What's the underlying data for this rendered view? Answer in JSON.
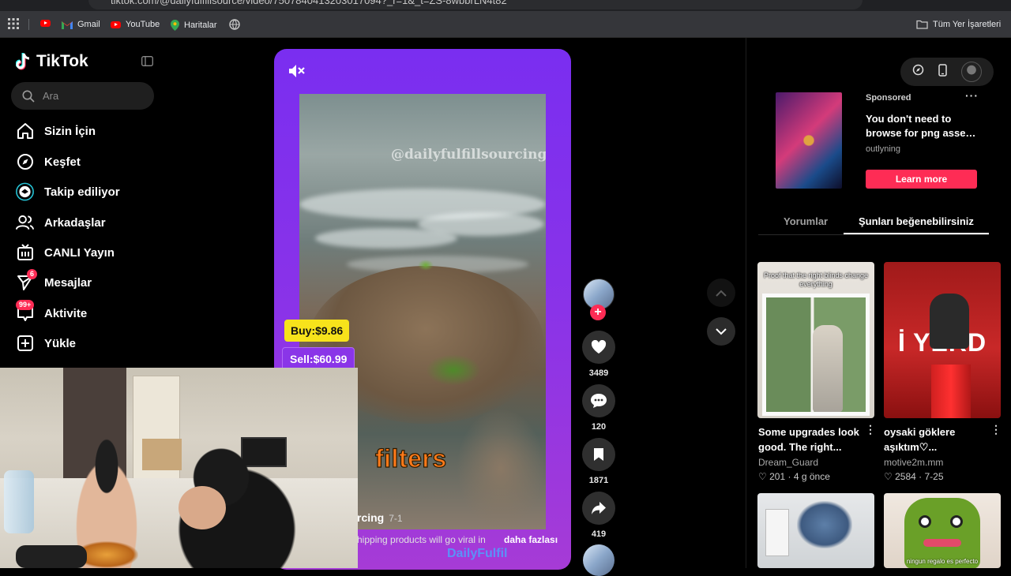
{
  "browser": {
    "url": "tiktok.com/@dailyfulfillsource/video/7507840413203017094?_r=1&_t=ZS-8wbbrLN4t82",
    "bookmarks": [
      {
        "label": "Gmail"
      },
      {
        "label": "YouTube"
      },
      {
        "label": "Haritalar"
      }
    ],
    "all_bookmarks_label": "Tüm Yer İşaretleri"
  },
  "sidebar": {
    "logo": "TikTok",
    "search_placeholder": "Ara",
    "items": [
      {
        "label": "Sizin İçin",
        "icon": "home-icon"
      },
      {
        "label": "Keşfet",
        "icon": "compass-icon"
      },
      {
        "label": "Takip ediliyor",
        "icon": "following-icon"
      },
      {
        "label": "Arkadaşlar",
        "icon": "friends-icon"
      },
      {
        "label": "CANLI Yayın",
        "icon": "live-icon"
      },
      {
        "label": "Mesajlar",
        "icon": "messages-icon",
        "badge": "6"
      },
      {
        "label": "Aktivite",
        "icon": "activity-icon",
        "badge": "99+"
      },
      {
        "label": "Yükle",
        "icon": "upload-icon"
      }
    ]
  },
  "video": {
    "watermark": "@dailyfulfillsourcing",
    "buy_label": "Buy:$9.86",
    "sell_label": "Sell:$60.99",
    "caption_word": "filters",
    "author_partial": "rcing",
    "date": "7-1",
    "description_partial": "hipping products will go viral in",
    "more_label": "daha fazlası",
    "brand_overlay": "DailyFulfil"
  },
  "actions": {
    "likes": "3489",
    "comments": "120",
    "saves": "1871",
    "shares": "419"
  },
  "ad": {
    "sponsored_label": "Sponsored",
    "text_line1": "You don't need to",
    "text_line2": "browse for png asset...",
    "brand": "outlyning",
    "button_label": "Learn more"
  },
  "tabs": [
    {
      "label": "Yorumlar",
      "active": false
    },
    {
      "label": "Şunları beğenebilirsiniz",
      "active": true
    }
  ],
  "recommendations": [
    {
      "thumb_caption": "Proof that the right blinds change everything",
      "title_line1": "Some upgrades look",
      "title_line2": "good. The right...",
      "author": "Dream_Guard",
      "likes": "201",
      "age": "4 g önce"
    },
    {
      "thumb_caption": "İ YERD",
      "title_line1": "oysaki göklere",
      "title_line2": "aşıktım♡...",
      "author": "motive2m.mm",
      "likes": "2584",
      "age": "7-25"
    },
    {
      "thumb_caption": "",
      "title_line1": "",
      "title_line2": "",
      "author": "",
      "likes": "",
      "age": ""
    },
    {
      "thumb_caption": "ningun regalo es perfecto",
      "title_line1": "",
      "title_line2": "",
      "author": "",
      "likes": "",
      "age": ""
    }
  ],
  "colors": {
    "accent": "#fe2c55",
    "video_frame": "#8a33e8",
    "buy_tag": "#f7e31b",
    "caption_word": "#ff7a1a"
  }
}
